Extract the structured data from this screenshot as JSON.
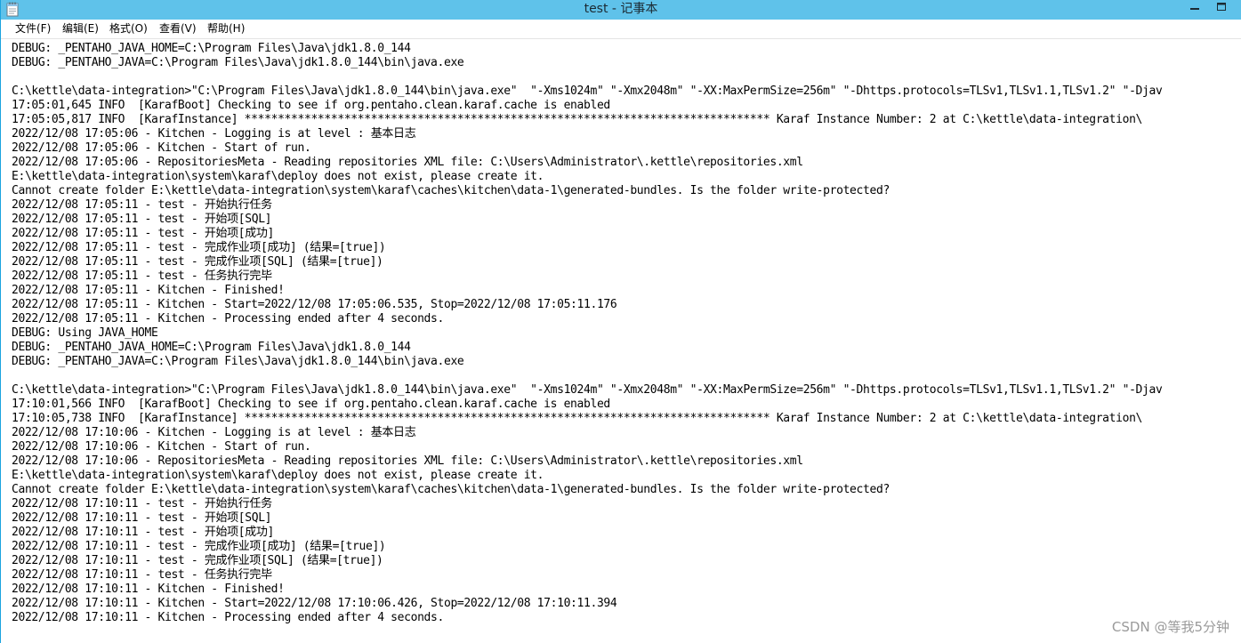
{
  "window": {
    "title": "test - 记事本",
    "title_bar_color": "#5fc2ea",
    "icon": "notepad-icon"
  },
  "menu": [
    {
      "label": "文件(F)",
      "name": "menu-file"
    },
    {
      "label": "编辑(E)",
      "name": "menu-edit"
    },
    {
      "label": "格式(O)",
      "name": "menu-format"
    },
    {
      "label": "查看(V)",
      "name": "menu-view"
    },
    {
      "label": "帮助(H)",
      "name": "menu-help"
    }
  ],
  "controls": {
    "minimize_icon": "minimize-icon",
    "maximize_icon": "maximize-icon"
  },
  "editor": {
    "lines": [
      "DEBUG: _PENTAHO_JAVA_HOME=C:\\Program Files\\Java\\jdk1.8.0_144",
      "DEBUG: _PENTAHO_JAVA=C:\\Program Files\\Java\\jdk1.8.0_144\\bin\\java.exe",
      "",
      "C:\\kettle\\data-integration>\"C:\\Program Files\\Java\\jdk1.8.0_144\\bin\\java.exe\"  \"-Xms1024m\" \"-Xmx2048m\" \"-XX:MaxPermSize=256m\" \"-Dhttps.protocols=TLSv1,TLSv1.1,TLSv1.2\" \"-Djav",
      "17:05:01,645 INFO  [KarafBoot] Checking to see if org.pentaho.clean.karaf.cache is enabled",
      "17:05:05,817 INFO  [KarafInstance] ******************************************************************************* Karaf Instance Number: 2 at C:\\kettle\\data-integration\\",
      "2022/12/08 17:05:06 - Kitchen - Logging is at level : 基本日志",
      "2022/12/08 17:05:06 - Kitchen - Start of run.",
      "2022/12/08 17:05:06 - RepositoriesMeta - Reading repositories XML file: C:\\Users\\Administrator\\.kettle\\repositories.xml",
      "E:\\kettle\\data-integration\\system\\karaf\\deploy does not exist, please create it.",
      "Cannot create folder E:\\kettle\\data-integration\\system\\karaf\\caches\\kitchen\\data-1\\generated-bundles. Is the folder write-protected?",
      "2022/12/08 17:05:11 - test - 开始执行任务",
      "2022/12/08 17:05:11 - test - 开始项[SQL]",
      "2022/12/08 17:05:11 - test - 开始项[成功]",
      "2022/12/08 17:05:11 - test - 完成作业项[成功] (结果=[true])",
      "2022/12/08 17:05:11 - test - 完成作业项[SQL] (结果=[true])",
      "2022/12/08 17:05:11 - test - 任务执行完毕",
      "2022/12/08 17:05:11 - Kitchen - Finished!",
      "2022/12/08 17:05:11 - Kitchen - Start=2022/12/08 17:05:06.535, Stop=2022/12/08 17:05:11.176",
      "2022/12/08 17:05:11 - Kitchen - Processing ended after 4 seconds.",
      "DEBUG: Using JAVA_HOME",
      "DEBUG: _PENTAHO_JAVA_HOME=C:\\Program Files\\Java\\jdk1.8.0_144",
      "DEBUG: _PENTAHO_JAVA=C:\\Program Files\\Java\\jdk1.8.0_144\\bin\\java.exe",
      "",
      "C:\\kettle\\data-integration>\"C:\\Program Files\\Java\\jdk1.8.0_144\\bin\\java.exe\"  \"-Xms1024m\" \"-Xmx2048m\" \"-XX:MaxPermSize=256m\" \"-Dhttps.protocols=TLSv1,TLSv1.1,TLSv1.2\" \"-Djav",
      "17:10:01,566 INFO  [KarafBoot] Checking to see if org.pentaho.clean.karaf.cache is enabled",
      "17:10:05,738 INFO  [KarafInstance] ******************************************************************************* Karaf Instance Number: 2 at C:\\kettle\\data-integration\\",
      "2022/12/08 17:10:06 - Kitchen - Logging is at level : 基本日志",
      "2022/12/08 17:10:06 - Kitchen - Start of run.",
      "2022/12/08 17:10:06 - RepositoriesMeta - Reading repositories XML file: C:\\Users\\Administrator\\.kettle\\repositories.xml",
      "E:\\kettle\\data-integration\\system\\karaf\\deploy does not exist, please create it.",
      "Cannot create folder E:\\kettle\\data-integration\\system\\karaf\\caches\\kitchen\\data-1\\generated-bundles. Is the folder write-protected?",
      "2022/12/08 17:10:11 - test - 开始执行任务",
      "2022/12/08 17:10:11 - test - 开始项[SQL]",
      "2022/12/08 17:10:11 - test - 开始项[成功]",
      "2022/12/08 17:10:11 - test - 完成作业项[成功] (结果=[true])",
      "2022/12/08 17:10:11 - test - 完成作业项[SQL] (结果=[true])",
      "2022/12/08 17:10:11 - test - 任务执行完毕",
      "2022/12/08 17:10:11 - Kitchen - Finished!",
      "2022/12/08 17:10:11 - Kitchen - Start=2022/12/08 17:10:06.426, Stop=2022/12/08 17:10:11.394",
      "2022/12/08 17:10:11 - Kitchen - Processing ended after 4 seconds."
    ]
  },
  "watermark": "CSDN @等我5分钟"
}
